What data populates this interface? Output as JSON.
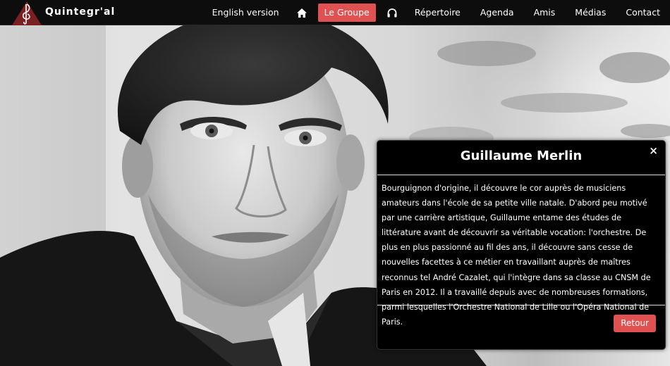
{
  "site": {
    "brand": "Quintegr'al"
  },
  "nav": {
    "english": "English version",
    "home_icon": "home-icon",
    "groupe": "Le Groupe",
    "audio_icon": "headphones-icon",
    "repertoire": "Répertoire",
    "agenda": "Agenda",
    "amis": "Amis",
    "medias": "Médias",
    "contact": "Contact"
  },
  "modal": {
    "title": "Guillaume Merlin",
    "close": "×",
    "body": "Bourguignon d'origine, il découvre le cor auprès de musiciens amateurs dans l'école de sa petite ville natale. D'abord peu motivé par une carrière artistique, Guillaume entame des études de littérature avant de découvrir sa véritable vocation: l'orchestre. De plus en plus passionné au fil des ans, il découvre sans cesse de nouvelles facettes à ce métier en travaillant auprès de maîtres reconnus tel André Cazalet, qui l'intègre dans sa classe au CNSM de Paris en 2012. Il a travaillé depuis avec de nombreuses formations, parmi lesquelles l'Orchestre National de Lille ou l'Opéra National de Paris.",
    "back": "Retour"
  },
  "colors": {
    "accent": "#e05152",
    "navbar": "#0d0d0d",
    "modal": "#000000"
  }
}
